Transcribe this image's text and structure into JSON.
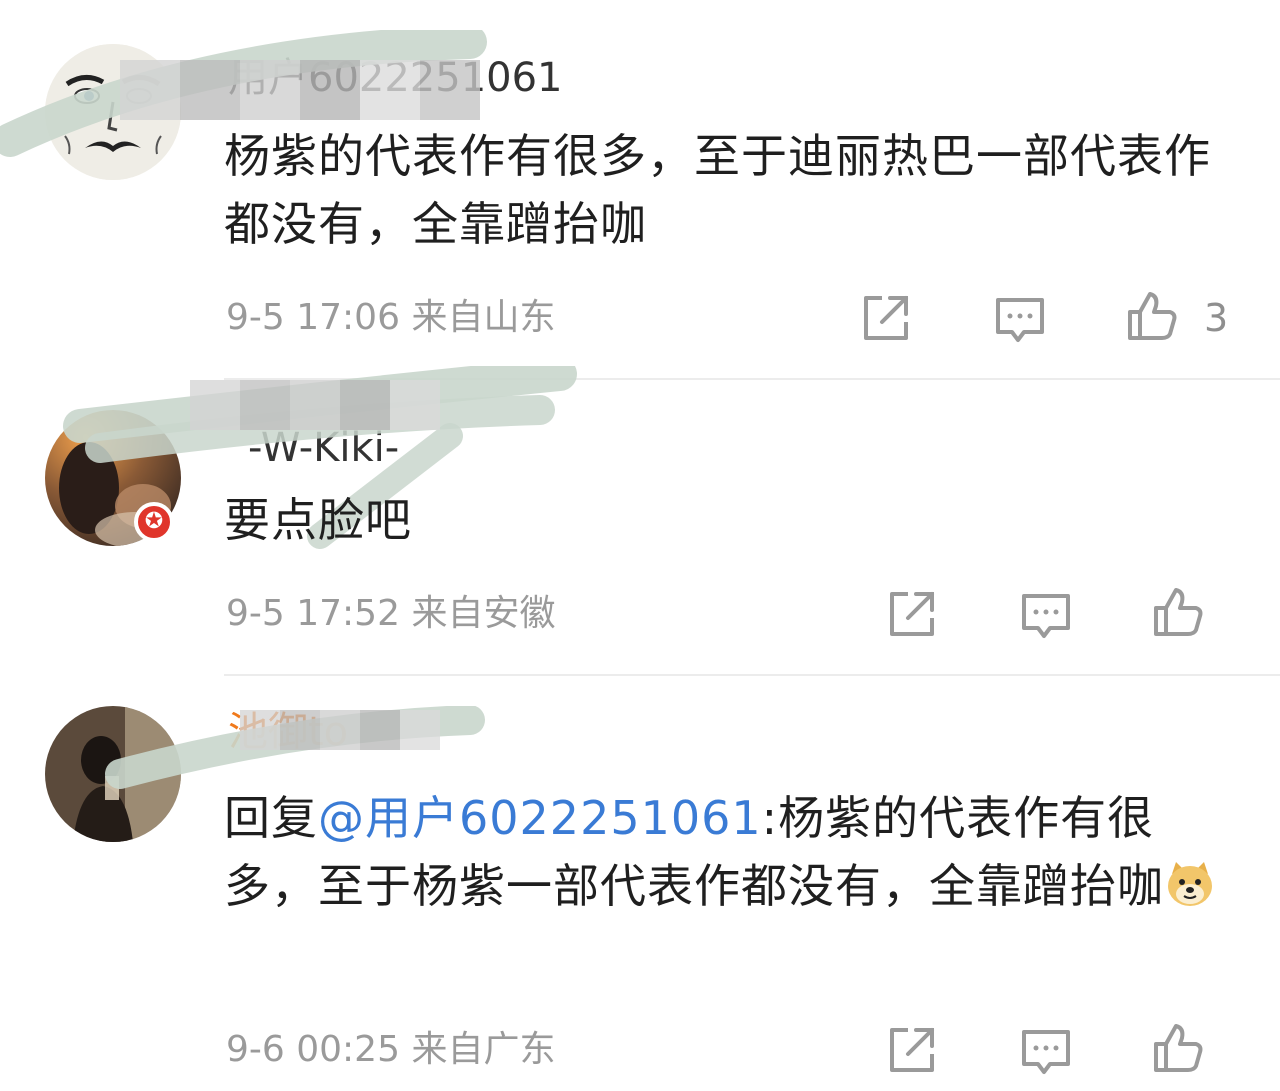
{
  "comments": [
    {
      "username": "用户6022251061",
      "text": "杨紫的代表作有很多，至于迪丽热巴一部代表作都没有，全靠蹭抬咖",
      "time": "9-5 17:06",
      "location": "来自山东",
      "like_count": "3"
    },
    {
      "username": "-W-Kiki-",
      "text": "要点脸吧",
      "time": "9-5 17:52",
      "location": "来自安徽",
      "badge": "✪"
    },
    {
      "username": "池御to",
      "reply_prefix": "回复",
      "mention": "@用户6022251061",
      "text": ":杨紫的代表作有很多，至于杨紫一部代表作都没有，全靠蹭抬咖",
      "time": "9-6 00:25",
      "location": "来自广东"
    }
  ],
  "icons": {
    "share": "share-icon",
    "comment": "comment-icon",
    "like": "like-icon",
    "emoji": "doge-emoji-icon"
  },
  "colors": {
    "mention": "#3a7bd5",
    "vip_username": "#f07a1c",
    "meta": "#9a9a9a",
    "badge": "#e0352b"
  }
}
